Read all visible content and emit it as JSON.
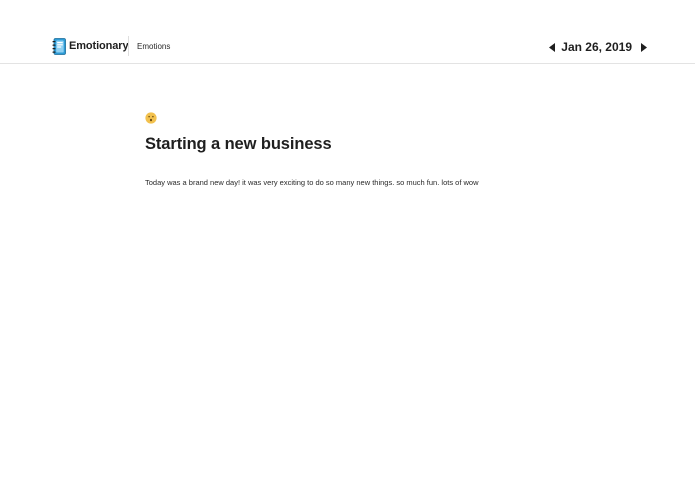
{
  "header": {
    "brand_name": "Emotionary",
    "nav_link": "Emotions",
    "date": "Jan 26, 2019",
    "icons": {
      "brand": "journal-icon",
      "prev": "caret-left-icon",
      "next": "caret-right-icon"
    }
  },
  "entry": {
    "mood_icon": "surprised-face-icon",
    "title": "Starting a new business",
    "body": "Today was a brand new day! it was very exciting to do so many new things. so much fun. lots of wow"
  },
  "colors": {
    "brand_blue": "#2d9bd6",
    "mood_yellow": "#f2c14e",
    "text": "#1f1f1f",
    "divider": "#e3e3e3"
  }
}
